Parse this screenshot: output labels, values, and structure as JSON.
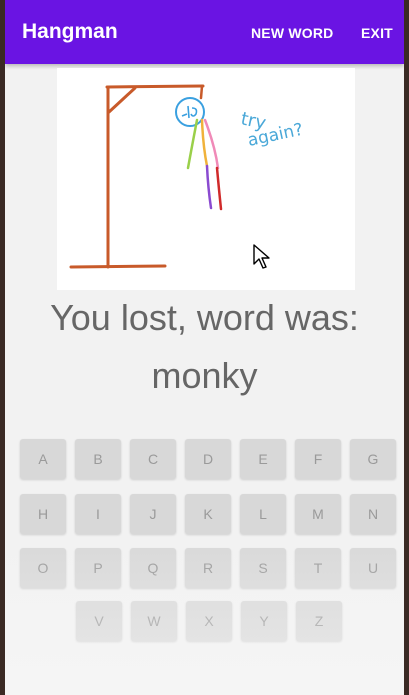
{
  "appbar": {
    "title": "Hangman",
    "new_word_label": "NEW WORD",
    "exit_label": "EXIT"
  },
  "drawing": {
    "annotation": [
      "try",
      "again?"
    ]
  },
  "status": {
    "line1": "You lost, word was:",
    "line2": "monky"
  },
  "keyboard": {
    "rows": [
      [
        "A",
        "B",
        "C",
        "D",
        "E",
        "F",
        "G"
      ],
      [
        "H",
        "I",
        "J",
        "K",
        "L",
        "M",
        "N"
      ],
      [
        "O",
        "P",
        "Q",
        "R",
        "S",
        "T",
        "U"
      ],
      [
        "V",
        "W",
        "X",
        "Y",
        "Z"
      ]
    ]
  },
  "colors": {
    "appbar": "#6a14e3",
    "gallows": "#c85a2a",
    "head": "#3aa0e0",
    "annotation": "#4aa8d8"
  }
}
